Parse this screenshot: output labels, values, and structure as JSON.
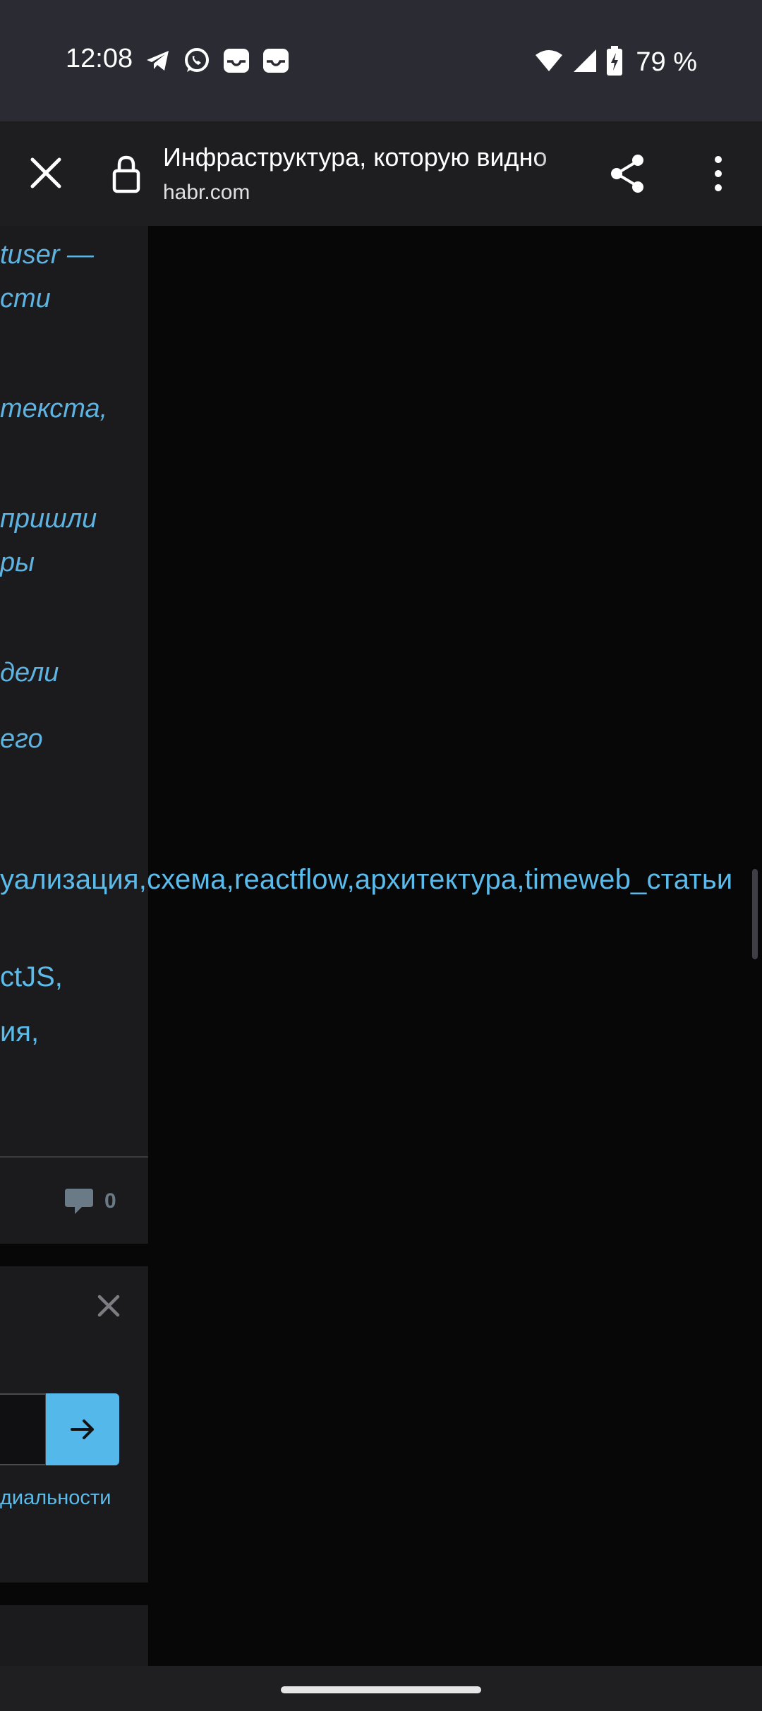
{
  "status_bar": {
    "time": "12:08",
    "left_icons": [
      "telegram-icon",
      "whatsapp-icon",
      "inbox-icon",
      "inbox-icon"
    ],
    "right_icons": [
      "wifi-icon",
      "signal-icon",
      "battery-charging-icon"
    ],
    "battery_percent": "79 %"
  },
  "toolbar": {
    "close_icon": "close-icon",
    "lock_icon": "lock-icon",
    "page_title": "Инфраструктура, которую видно",
    "url": "habr.com",
    "share_icon": "share-icon",
    "menu_icon": "more-vert-icon"
  },
  "article": {
    "lines": [
      "tuser —",
      "сти",
      "текста,",
      "пришли",
      "ры",
      "дели",
      "его"
    ],
    "tags": "уализация,схема,reactflow,архитектура,timeweb_статьи",
    "hubs": [
      "ctJS,",
      "ия,"
    ],
    "comments_count": "0"
  },
  "subscribe": {
    "policy_text": "диальности"
  },
  "colors": {
    "status_bg": "#2b2b34",
    "toolbar_bg": "#1e1e21",
    "page_bg": "#070708",
    "panel_bg": "#1b1b1d",
    "link": "#5bbbea",
    "button": "#54b8ea"
  }
}
